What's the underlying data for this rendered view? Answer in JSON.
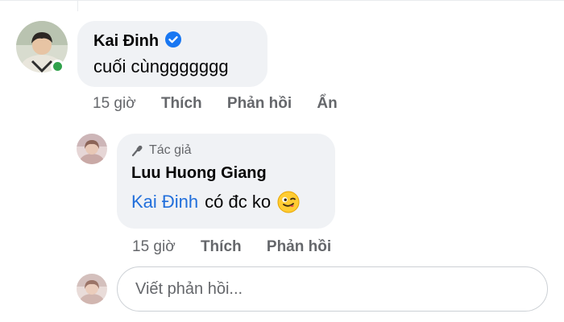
{
  "comment": {
    "author": "Kai Đinh",
    "text": "cuối cùnggggggg",
    "time": "15 giờ",
    "like_label": "Thích",
    "reply_label": "Phản hồi",
    "hide_label": "Ẩn"
  },
  "reply": {
    "badge": "Tác giả",
    "author": "Luu Huong Giang",
    "mention": "Kai Đinh",
    "text": "có đc ko",
    "time": "15 giờ",
    "like_label": "Thích",
    "reply_label": "Phản hồi"
  },
  "composer": {
    "placeholder": "Viết phản hồi..."
  },
  "icons": {
    "verified": "verified-badge-icon",
    "online": "online-status-icon",
    "author_badge": "microphone-icon",
    "emoji": "winking-tongue-emoji-icon"
  },
  "colors": {
    "verified": "#1877f2",
    "online": "#31a24c",
    "mention": "#216fdb",
    "bubble": "#f0f2f5"
  }
}
